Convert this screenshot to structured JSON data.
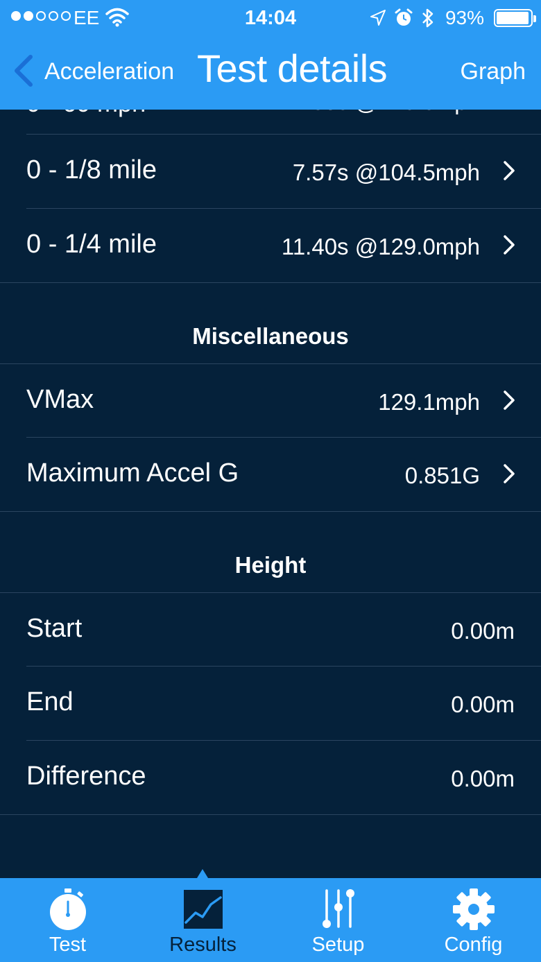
{
  "status_bar": {
    "carrier": "EE",
    "time": "14:04",
    "battery": "93%"
  },
  "nav": {
    "back_label": "Acceleration",
    "title": "Test details",
    "graph_label": "Graph"
  },
  "rows_top": [
    {
      "label": "0 - 1/8 mile",
      "value": "7.57s @104.5mph"
    },
    {
      "label": "0 - 1/4 mile",
      "value": "11.40s @129.0mph"
    }
  ],
  "misc": {
    "header": "Miscellaneous",
    "rows": [
      {
        "label": "VMax",
        "value": "129.1mph"
      },
      {
        "label": "Maximum Accel G",
        "value": "0.851G"
      }
    ]
  },
  "height": {
    "header": "Height",
    "rows": [
      {
        "label": "Start",
        "value": "0.00m"
      },
      {
        "label": "End",
        "value": "0.00m"
      },
      {
        "label": "Difference",
        "value": "0.00m"
      }
    ]
  },
  "tabs": [
    {
      "label": "Test",
      "icon": "stopwatch-icon"
    },
    {
      "label": "Results",
      "icon": "chart-icon",
      "selected": true
    },
    {
      "label": "Setup",
      "icon": "sliders-icon"
    },
    {
      "label": "Config",
      "icon": "gear-icon"
    }
  ],
  "colors": {
    "accent": "#2b9bf4",
    "background": "#05213a",
    "separator": "#2b4560"
  }
}
